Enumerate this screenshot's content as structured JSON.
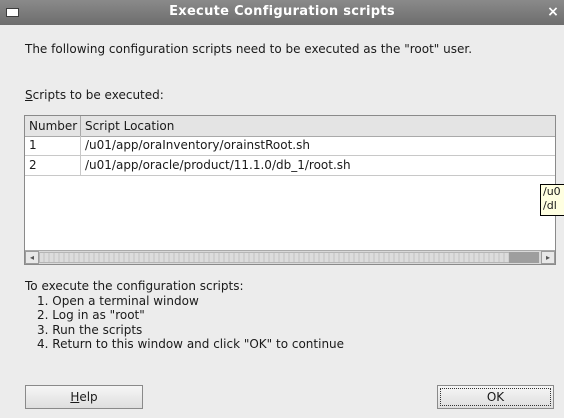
{
  "window": {
    "title": "Execute Configuration scripts",
    "close_glyph": "×"
  },
  "intro": "The following configuration scripts need to be executed as the \"root\" user.",
  "scripts_label_ul": "S",
  "scripts_label_rest": "cripts to be executed:",
  "table": {
    "columns": [
      "Number",
      "Script Location"
    ],
    "rows": [
      {
        "number": "1",
        "location": "/u01/app/oraInventory/orainstRoot.sh"
      },
      {
        "number": "2",
        "location": "/u01/app/oracle/product/11.1.0/db_1/root.sh"
      }
    ],
    "scroll_left": "◂",
    "scroll_right": "▸"
  },
  "tooltip": {
    "line1": "/u0",
    "line2": "/dl"
  },
  "instructions": {
    "heading": "To execute the configuration scripts:",
    "steps": [
      "1. Open a terminal window",
      "2. Log in as \"root\"",
      "3. Run the scripts",
      "4. Return to this window and click \"OK\" to continue"
    ]
  },
  "buttons": {
    "help_ul": "H",
    "help_rest": "elp",
    "ok": "OK"
  }
}
